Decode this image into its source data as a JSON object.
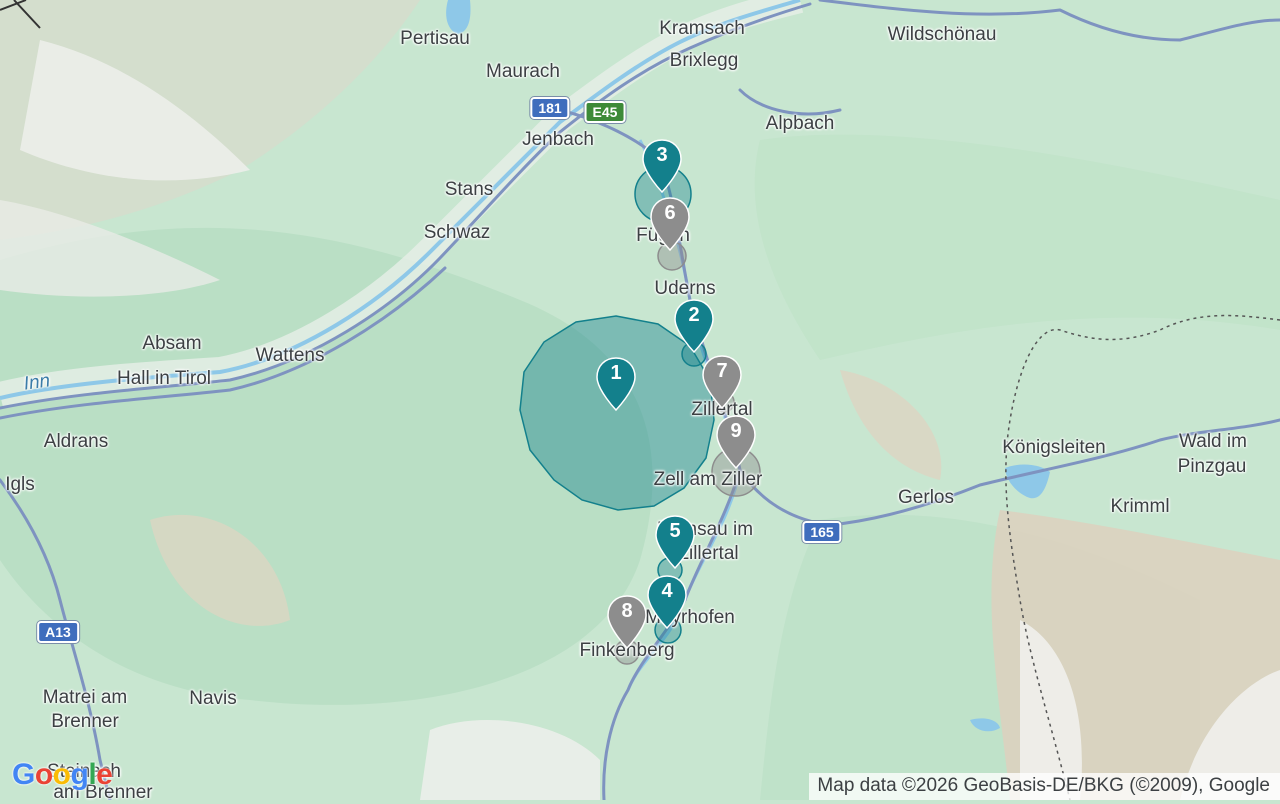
{
  "map": {
    "place_labels": [
      {
        "text": "Pertisau"
      },
      {
        "text": "Maurach"
      },
      {
        "text": "Kramsach"
      },
      {
        "text": "Brixlegg"
      },
      {
        "text": "Wildschönau"
      },
      {
        "text": "Alpbach"
      },
      {
        "text": "Jenbach"
      },
      {
        "text": "Stans"
      },
      {
        "text": "Schwaz"
      },
      {
        "text": "Fügen"
      },
      {
        "text": "Uderns"
      },
      {
        "text": "Absam"
      },
      {
        "text": "Wattens"
      },
      {
        "text": "Hall in Tirol"
      },
      {
        "text": "Inn"
      },
      {
        "text": "Aldrans"
      },
      {
        "text": "Igls"
      },
      {
        "text": "Zillertal"
      },
      {
        "text": "Zell am Ziller"
      },
      {
        "text": "Gerlos"
      },
      {
        "text": "Königsleiten"
      },
      {
        "text": "Wald im"
      },
      {
        "text": "Pinzgau"
      },
      {
        "text": "Krimml"
      },
      {
        "text": "Ramsau im"
      },
      {
        "text": "Zillertal"
      },
      {
        "text": "Mayrhofen"
      },
      {
        "text": "Finkenberg"
      },
      {
        "text": "Matrei am"
      },
      {
        "text": "Brenner"
      },
      {
        "text": "Navis"
      },
      {
        "text": "Steinach"
      },
      {
        "text": "am Brenner"
      }
    ],
    "road_shields": [
      {
        "text": "181",
        "color": "#3f6dbd"
      },
      {
        "text": "E45",
        "color": "#3d8a38"
      },
      {
        "text": "165",
        "color": "#3f6dbd"
      },
      {
        "text": "A13",
        "color": "#3f6dbd"
      }
    ],
    "markers": [
      {
        "number": "1",
        "color": "#13808c",
        "status": "active"
      },
      {
        "number": "2",
        "color": "#13808c",
        "status": "active"
      },
      {
        "number": "3",
        "color": "#13808c",
        "status": "active"
      },
      {
        "number": "4",
        "color": "#13808c",
        "status": "active"
      },
      {
        "number": "5",
        "color": "#13808c",
        "status": "active"
      },
      {
        "number": "6",
        "color": "#8d8d8d",
        "status": "inactive"
      },
      {
        "number": "7",
        "color": "#8d8d8d",
        "status": "inactive"
      },
      {
        "number": "8",
        "color": "#8d8d8d",
        "status": "inactive"
      },
      {
        "number": "9",
        "color": "#8d8d8d",
        "status": "inactive"
      }
    ],
    "attribution": "Map data ©2026 GeoBasis-DE/BKG (©2009), Google",
    "logo": "Google",
    "colors": {
      "terrain": "#c8e6d0",
      "mountain": "#dcd4c4",
      "snow": "#f4f4f4",
      "water": "#8ec8e8",
      "road": "#7e93c0",
      "active_marker": "#13808c",
      "inactive_marker": "#8d8d8d"
    }
  }
}
